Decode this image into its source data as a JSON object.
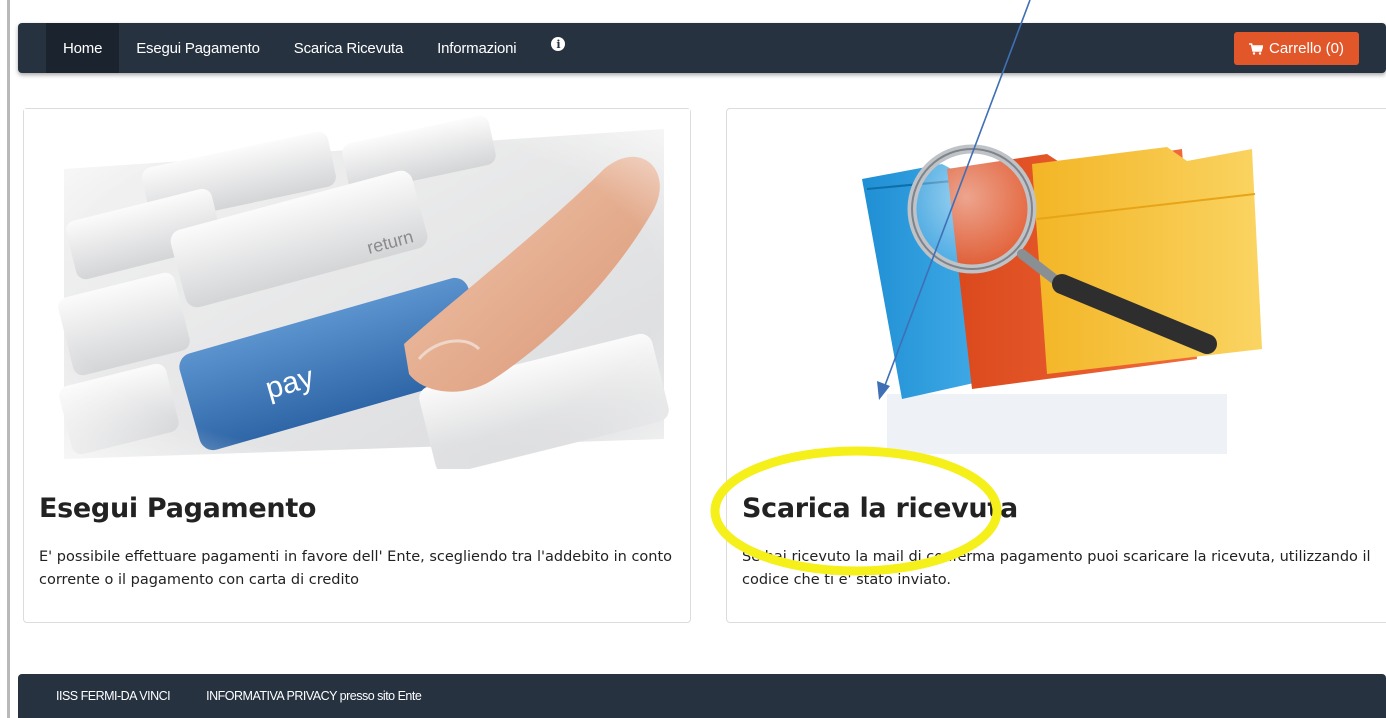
{
  "navbar": {
    "items": [
      {
        "label": "Home",
        "active": true
      },
      {
        "label": "Esegui Pagamento",
        "active": false
      },
      {
        "label": "Scarica Ricevuta",
        "active": false
      },
      {
        "label": "Informazioni",
        "active": false
      }
    ],
    "info_icon": "info-circle-icon",
    "cart_label": "Carrello (0)",
    "cart_icon": "shopping-cart-icon"
  },
  "cards": [
    {
      "title": "Esegui Pagamento",
      "text": "E' possibile effettuare pagamenti in favore dell' Ente, scegliendo tra l'addebito in conto corrente o il pagamento con carta di credito",
      "image_key_label": "pay",
      "image_key2_label": "return"
    },
    {
      "title": "Scarica la ricevuta",
      "text": "Se hai ricevuto la mail di conferma pagamento puoi scaricare la ricevuta, utilizzando il codice che ti e' stato inviato."
    }
  ],
  "footer": {
    "links": [
      "IISS FERMI-DA VINCI",
      "INFORMATIVA PRIVACY presso sito Ente"
    ]
  },
  "colors": {
    "navbar_bg": "#263240",
    "cart_bg": "#e2572a",
    "highlight_ellipse": "#f5ef1a",
    "arrow": "#3f6fb5"
  }
}
